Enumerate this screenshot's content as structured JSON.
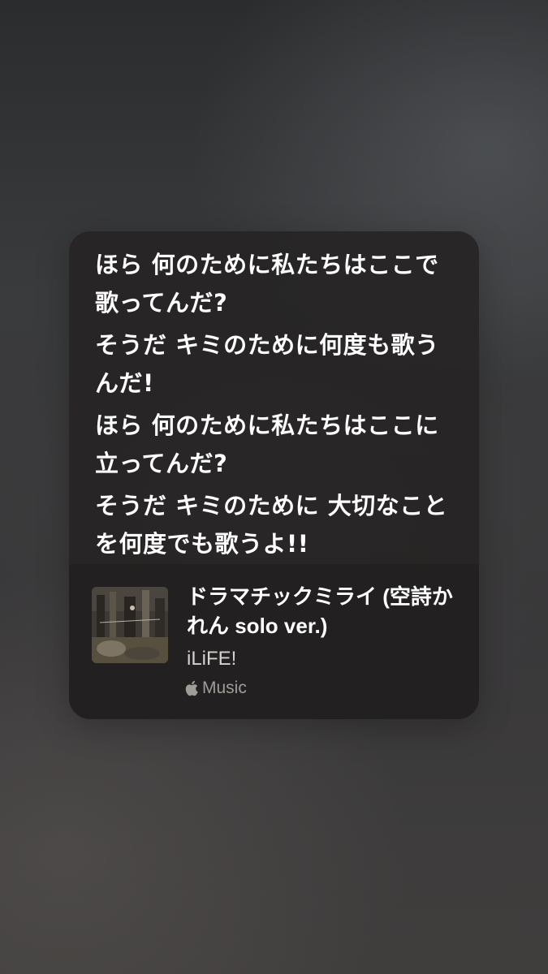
{
  "lyrics": {
    "lines": [
      "ほら 何のために私たちはここで歌ってんだ?",
      "そうだ キミのために何度も歌うんだ!",
      "ほら 何のために私たちはここに立ってんだ?",
      "そうだ キミのために 大切なことを何度でも歌うよ!!"
    ]
  },
  "track": {
    "title": "ドラマチックミライ (空詩かれん solo ver.)",
    "artist": "iLiFE!",
    "service_label": "Music",
    "service_icon": "apple-logo-icon",
    "artwork_icon": "album-artwork"
  },
  "colors": {
    "card_background": "#262424",
    "track_background": "#222020",
    "lyric_text": "#ffffff",
    "secondary_text": "#a09c98"
  }
}
